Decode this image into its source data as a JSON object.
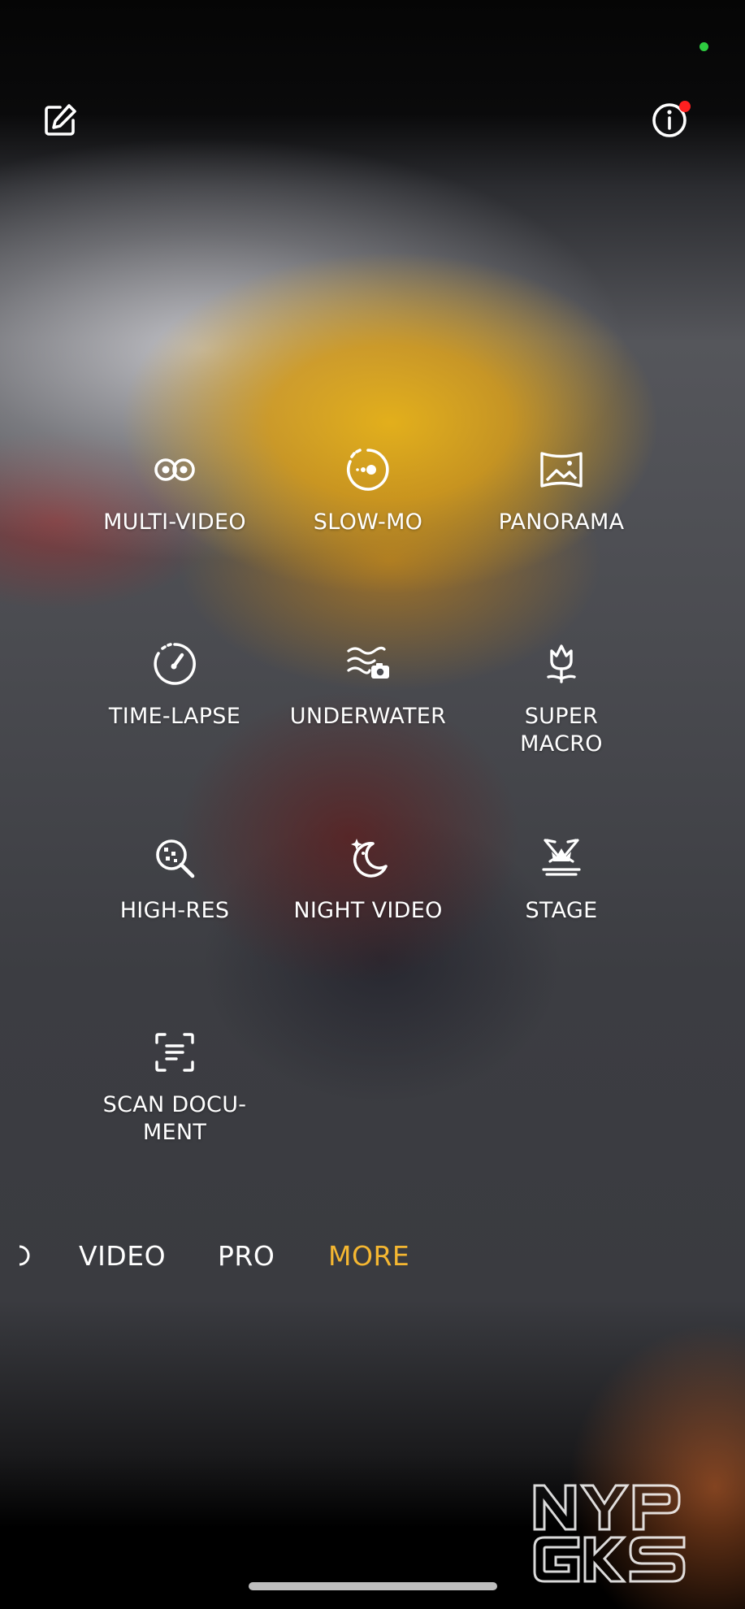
{
  "status": {
    "indicator_color": "#2ecc40"
  },
  "top_bar": {
    "edit_icon": "edit-icon",
    "info_icon": "info-icon",
    "info_badge_color": "#ff2020"
  },
  "modes": [
    {
      "label": "MULTI-VIDEO",
      "icon": "multi-video-icon"
    },
    {
      "label": "SLOW-MO",
      "icon": "slow-mo-icon"
    },
    {
      "label": "PANORAMA",
      "icon": "panorama-icon"
    },
    {
      "label": "TIME-LAPSE",
      "icon": "time-lapse-icon"
    },
    {
      "label": "UNDERWATER",
      "icon": "underwater-icon"
    },
    {
      "label": "SUPER\nMACRO",
      "icon": "super-macro-icon"
    },
    {
      "label": "HIGH-RES",
      "icon": "high-res-icon"
    },
    {
      "label": "NIGHT VIDEO",
      "icon": "night-video-icon"
    },
    {
      "label": "STAGE",
      "icon": "stage-icon"
    },
    {
      "label": "SCAN DOCU-\nMENT",
      "icon": "scan-document-icon"
    }
  ],
  "tabs": [
    {
      "label": "VIDEO",
      "active": false
    },
    {
      "label": "PRO",
      "active": false
    },
    {
      "label": "MORE",
      "active": true
    }
  ],
  "accent_color": "#f5b731",
  "watermark": {
    "line1": "NYP",
    "line2": "GKS"
  }
}
